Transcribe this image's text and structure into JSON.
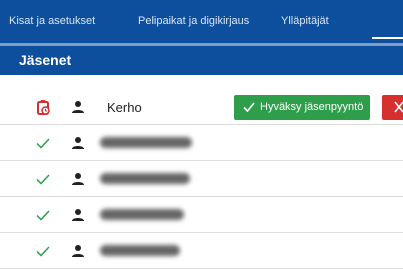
{
  "nav": {
    "tabs": [
      "Kisat ja asetukset",
      "Pelipaikat ja digikirjaus",
      "Ylläpitäjät"
    ]
  },
  "section": {
    "title": "Jäsenet"
  },
  "members": [
    {
      "status": "pending-icon",
      "name": "Kerho",
      "approve_label": "Hyväksy jäsenpyyntö"
    },
    {
      "status": "check-icon",
      "name": ""
    },
    {
      "status": "check-icon",
      "name": ""
    },
    {
      "status": "check-icon",
      "name": ""
    },
    {
      "status": "check-icon",
      "name": ""
    }
  ],
  "colors": {
    "nav_bg": "#0d4f9c",
    "approve": "#2e9e4b",
    "reject": "#d52f2f",
    "check": "#2e9e4b",
    "pending": "#d52f2f"
  }
}
